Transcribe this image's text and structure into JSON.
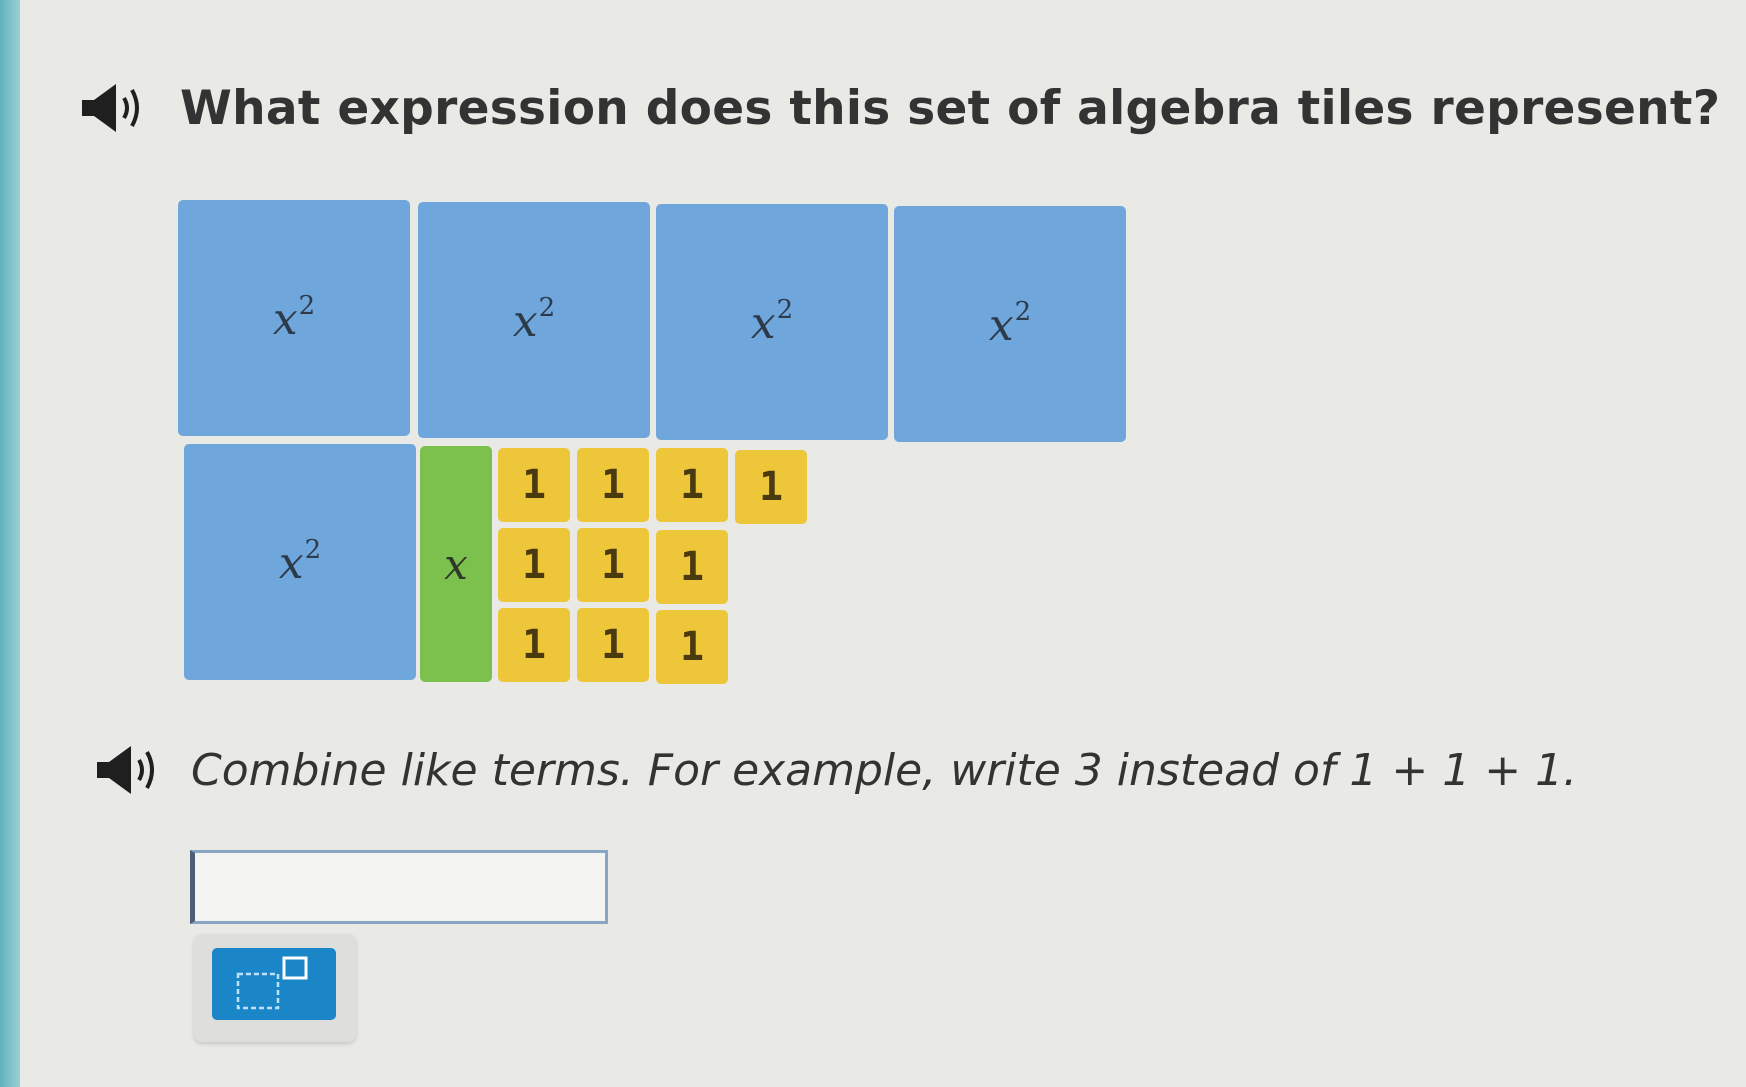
{
  "question": {
    "text": "What expression does this set of algebra tiles represent?",
    "audio_icon": "speaker-icon"
  },
  "tiles": {
    "x_squared": [
      {
        "label": "x",
        "exponent": "2"
      },
      {
        "label": "x",
        "exponent": "2"
      },
      {
        "label": "x",
        "exponent": "2"
      },
      {
        "label": "x",
        "exponent": "2"
      },
      {
        "label": "x",
        "exponent": "2"
      }
    ],
    "x": [
      {
        "label": "x"
      }
    ],
    "ones": [
      {
        "label": "1"
      },
      {
        "label": "1"
      },
      {
        "label": "1"
      },
      {
        "label": "1"
      },
      {
        "label": "1"
      },
      {
        "label": "1"
      },
      {
        "label": "1"
      },
      {
        "label": "1"
      },
      {
        "label": "1"
      },
      {
        "label": "1"
      }
    ],
    "colors": {
      "x_squared": "#6fa6dc",
      "x": "#7cc04e",
      "one": "#eec63a"
    }
  },
  "instruction": {
    "text": "Combine like terms. For example, write 3 instead of 1 + 1 + 1.",
    "audio_icon": "speaker-icon"
  },
  "answer": {
    "value": "",
    "placeholder": ""
  },
  "toolbar": {
    "exponent_button_icon": "exponent-template-icon",
    "accent": "#1a86c8"
  }
}
